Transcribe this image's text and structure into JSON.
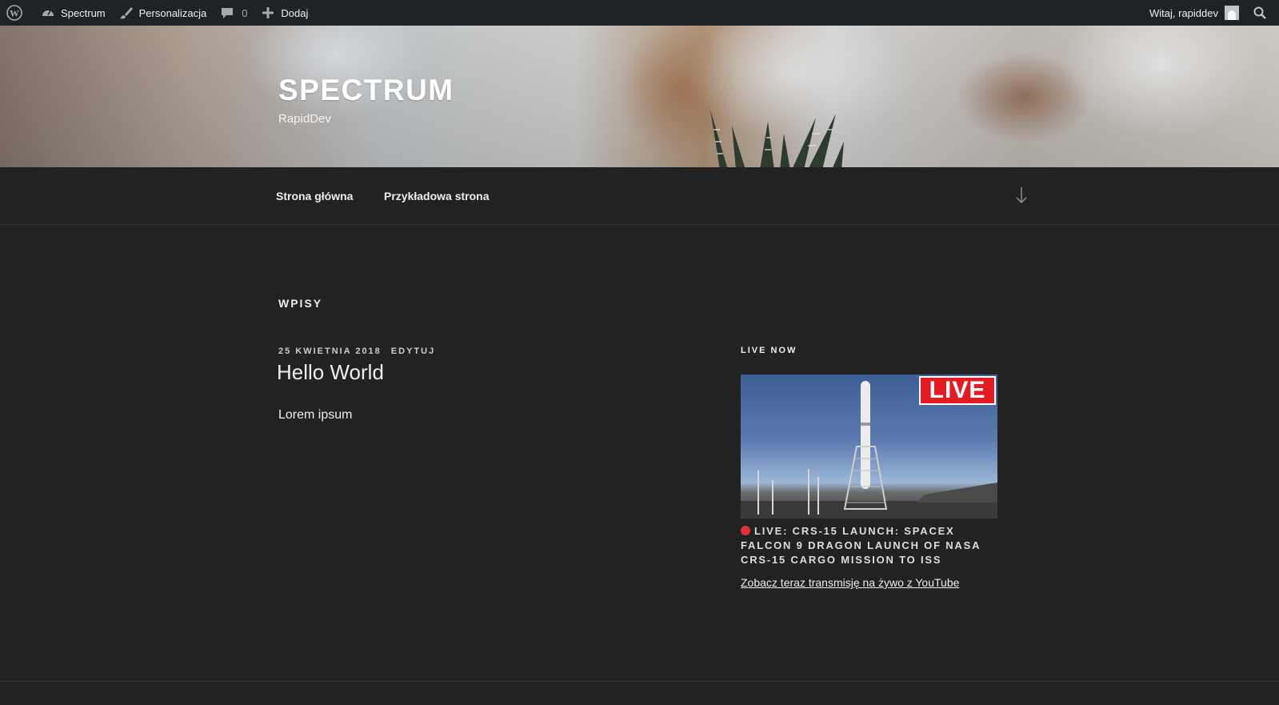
{
  "adminbar": {
    "site_name": "Spectrum",
    "customize": "Personalizacja",
    "comments_count": "0",
    "new_label": "Dodaj",
    "greeting": "Witaj, rapiddev"
  },
  "header": {
    "site_title": "SPECTRUM",
    "site_description": "RapidDev"
  },
  "nav": {
    "items": [
      "Strona główna",
      "Przykładowa strona"
    ]
  },
  "main": {
    "section_title": "WPISY",
    "post": {
      "date": "25 KWIETNIA 2018",
      "edit": "EDYTUJ",
      "title": "Hello World",
      "content": "Lorem ipsum"
    }
  },
  "widget": {
    "title": "LIVE NOW",
    "badge": "LIVE",
    "headline": "LIVE: CRS-15 LAUNCH: SPACEX FALCON 9 DRAGON LAUNCH OF NASA CRS-15 CARGO MISSION TO ISS",
    "link_text": "Zobacz teraz transmisję na żywo z YouTube"
  },
  "colors": {
    "admin_bar": "#1d2327",
    "page_bg": "#222222",
    "live_red": "#e31b23"
  }
}
